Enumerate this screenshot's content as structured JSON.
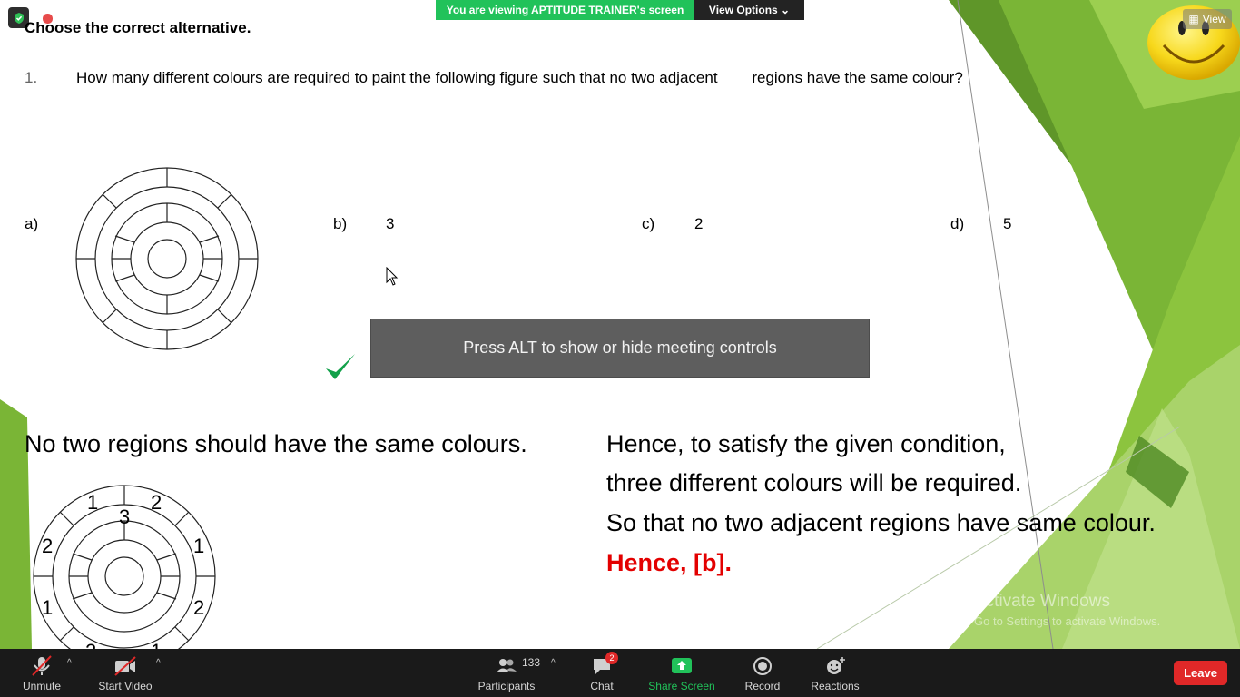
{
  "banner": {
    "viewing": "You are viewing APTITUDE TRAINER's screen",
    "view_options": "View Options ⌄"
  },
  "view_button": "View",
  "slide": {
    "heading": "Choose the correct alternative.",
    "question_number": "1.",
    "question_text": "How many different colours are required to paint the following figure such that no two adjacent        regions have the same colour?",
    "options": [
      {
        "letter": "a)",
        "value": ""
      },
      {
        "letter": "b)",
        "value": "3"
      },
      {
        "letter": "c)",
        "value": "2"
      },
      {
        "letter": "d)",
        "value": "5"
      }
    ],
    "explanation_left": "No two regions should have the same colours.",
    "explanation_right": [
      "Hence, to satisfy the given condition,",
      "three different colours will be required.",
      "So that no two adjacent regions have same colour."
    ],
    "answer": "Hence, [b].",
    "figure_labels": [
      "1",
      "2",
      "3",
      "2",
      "1",
      "1",
      "2",
      "2",
      "1"
    ]
  },
  "tooltip": "Press ALT to show or hide meeting controls",
  "watermark": {
    "title": "Activate Windows",
    "subtitle": "Go to Settings to activate Windows."
  },
  "toolbar": {
    "unmute": "Unmute",
    "start_video": "Start Video",
    "participants": "Participants",
    "participants_count": "133",
    "chat": "Chat",
    "chat_badge": "2",
    "share_screen": "Share Screen",
    "record": "Record",
    "reactions": "Reactions",
    "leave": "Leave"
  },
  "colors": {
    "share_green": "#21c25a",
    "leave_red": "#e02828",
    "answer_red": "#e30000",
    "check_green": "#12a14a",
    "toolbar_bg": "#1a1a1a"
  }
}
